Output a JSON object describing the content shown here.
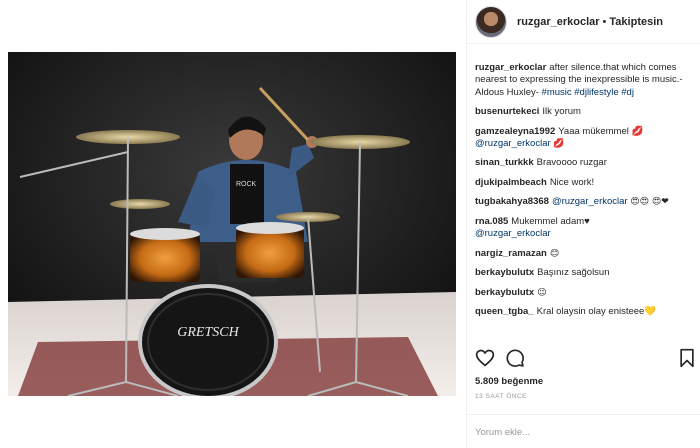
{
  "post": {
    "author": "ruzgar_erkoclar",
    "separator": "•",
    "follow_label": "Takiptesin",
    "likes": "5.809 beğenme",
    "time_ago": "13 SAAT ÖNCE",
    "comment_placeholder": "Yorum ekle..."
  },
  "caption": {
    "user": "ruzgar_erkoclar",
    "text": "after silence.that which comes nearest to expressing the inexpressible is music.-Aldous Huxley-",
    "hashtags": "#music #djlifestyle #dj"
  },
  "comments": [
    {
      "user": "busenurtekeci",
      "text": "Ilk yorum"
    },
    {
      "user": "gamzealeyna1992",
      "text": "Yaaa mükemmel 💋",
      "mention": "@ruzgar_erkoclar",
      "after": "💋"
    },
    {
      "user": "sinan_turkkk",
      "text": "Bravoooo ruzgar"
    },
    {
      "user": "djukipalmbeach",
      "text": "Nice work!"
    },
    {
      "user": "tugbakahya8368",
      "mention": "@ruzgar_erkoclar",
      "after": "😍😍 😍❤"
    },
    {
      "user": "rna.085",
      "text": "Mukemmel adam♥",
      "mention": "@ruzgar_erkoclar"
    },
    {
      "user": "nargiz_ramazan",
      "text": "😊"
    },
    {
      "user": "berkaybulutx",
      "text": "Başınız sağolsun"
    },
    {
      "user": "berkaybulutx",
      "text": "😉"
    },
    {
      "user": "queen_tgba_",
      "text": "Kral olaysin olay enisteee💛"
    }
  ],
  "icons": {
    "like": "heart-icon",
    "comment": "comment-bubble-icon",
    "save": "bookmark-icon",
    "avatar": "avatar"
  },
  "drum_brand": "GRETSCH"
}
